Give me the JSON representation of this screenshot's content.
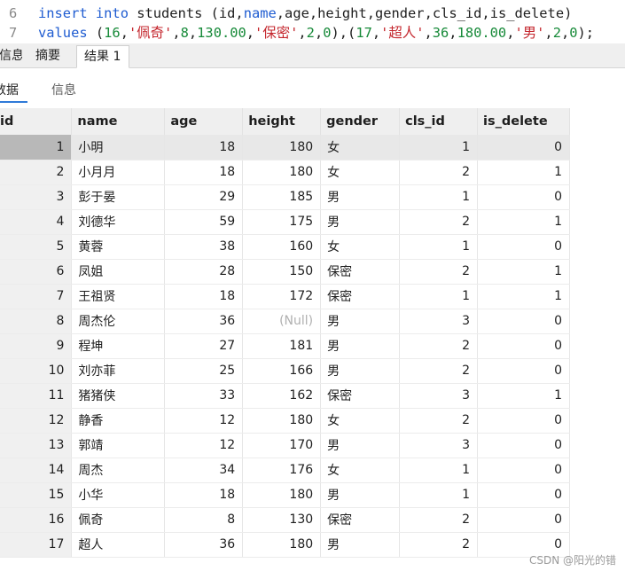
{
  "editor": {
    "lines": [
      {
        "number": "6",
        "tokens": [
          {
            "text": "insert",
            "kind": "kw"
          },
          {
            "text": " ",
            "kind": "plain"
          },
          {
            "text": "into",
            "kind": "kw"
          },
          {
            "text": " students (id,",
            "kind": "plain"
          },
          {
            "text": "name",
            "kind": "kw"
          },
          {
            "text": ",age,height,gender,cls_id,is_delete)",
            "kind": "plain"
          }
        ]
      },
      {
        "number": "7",
        "tokens": [
          {
            "text": "values",
            "kind": "kw"
          },
          {
            "text": " (",
            "kind": "plain"
          },
          {
            "text": "16",
            "kind": "num"
          },
          {
            "text": ",",
            "kind": "plain"
          },
          {
            "text": "'佩奇'",
            "kind": "str"
          },
          {
            "text": ",",
            "kind": "plain"
          },
          {
            "text": "8",
            "kind": "num"
          },
          {
            "text": ",",
            "kind": "plain"
          },
          {
            "text": "130.00",
            "kind": "num"
          },
          {
            "text": ",",
            "kind": "plain"
          },
          {
            "text": "'保密'",
            "kind": "str"
          },
          {
            "text": ",",
            "kind": "plain"
          },
          {
            "text": "2",
            "kind": "num"
          },
          {
            "text": ",",
            "kind": "plain"
          },
          {
            "text": "0",
            "kind": "num"
          },
          {
            "text": "),(",
            "kind": "plain"
          },
          {
            "text": "17",
            "kind": "num"
          },
          {
            "text": ",",
            "kind": "plain"
          },
          {
            "text": "'超人'",
            "kind": "str"
          },
          {
            "text": ",",
            "kind": "plain"
          },
          {
            "text": "36",
            "kind": "num"
          },
          {
            "text": ",",
            "kind": "plain"
          },
          {
            "text": "180.00",
            "kind": "num"
          },
          {
            "text": ",",
            "kind": "plain"
          },
          {
            "text": "'男'",
            "kind": "str"
          },
          {
            "text": ",",
            "kind": "plain"
          },
          {
            "text": "2",
            "kind": "num"
          },
          {
            "text": ",",
            "kind": "plain"
          },
          {
            "text": "0",
            "kind": "num"
          },
          {
            "text": ");",
            "kind": "plain"
          }
        ]
      }
    ]
  },
  "tabs": {
    "info": "信息",
    "summary": "摘要",
    "result": "结果 1"
  },
  "subtabs": {
    "data": "数据",
    "info": "信息"
  },
  "grid": {
    "columns": [
      "id",
      "name",
      "age",
      "height",
      "gender",
      "cls_id",
      "is_delete"
    ],
    "rows": [
      [
        "1",
        "小明",
        "18",
        "180",
        "女",
        "1",
        "0"
      ],
      [
        "2",
        "小月月",
        "18",
        "180",
        "女",
        "2",
        "1"
      ],
      [
        "3",
        "彭于晏",
        "29",
        "185",
        "男",
        "1",
        "0"
      ],
      [
        "4",
        "刘德华",
        "59",
        "175",
        "男",
        "2",
        "1"
      ],
      [
        "5",
        "黄蓉",
        "38",
        "160",
        "女",
        "1",
        "0"
      ],
      [
        "6",
        "凤姐",
        "28",
        "150",
        "保密",
        "2",
        "1"
      ],
      [
        "7",
        "王祖贤",
        "18",
        "172",
        "保密",
        "1",
        "1"
      ],
      [
        "8",
        "周杰伦",
        "36",
        "(Null)",
        "男",
        "3",
        "0"
      ],
      [
        "9",
        "程坤",
        "27",
        "181",
        "男",
        "2",
        "0"
      ],
      [
        "10",
        "刘亦菲",
        "25",
        "166",
        "男",
        "2",
        "0"
      ],
      [
        "11",
        "猪猪侠",
        "33",
        "162",
        "保密",
        "3",
        "1"
      ],
      [
        "12",
        "静香",
        "12",
        "180",
        "女",
        "2",
        "0"
      ],
      [
        "13",
        "郭靖",
        "12",
        "170",
        "男",
        "3",
        "0"
      ],
      [
        "14",
        "周杰",
        "34",
        "176",
        "女",
        "1",
        "0"
      ],
      [
        "15",
        "小华",
        "18",
        "180",
        "男",
        "1",
        "0"
      ],
      [
        "16",
        "佩奇",
        "8",
        "130",
        "保密",
        "2",
        "0"
      ],
      [
        "17",
        "超人",
        "36",
        "180",
        "男",
        "2",
        "0"
      ]
    ],
    "selected_row": 0
  },
  "watermark": "CSDN @阳光的错"
}
